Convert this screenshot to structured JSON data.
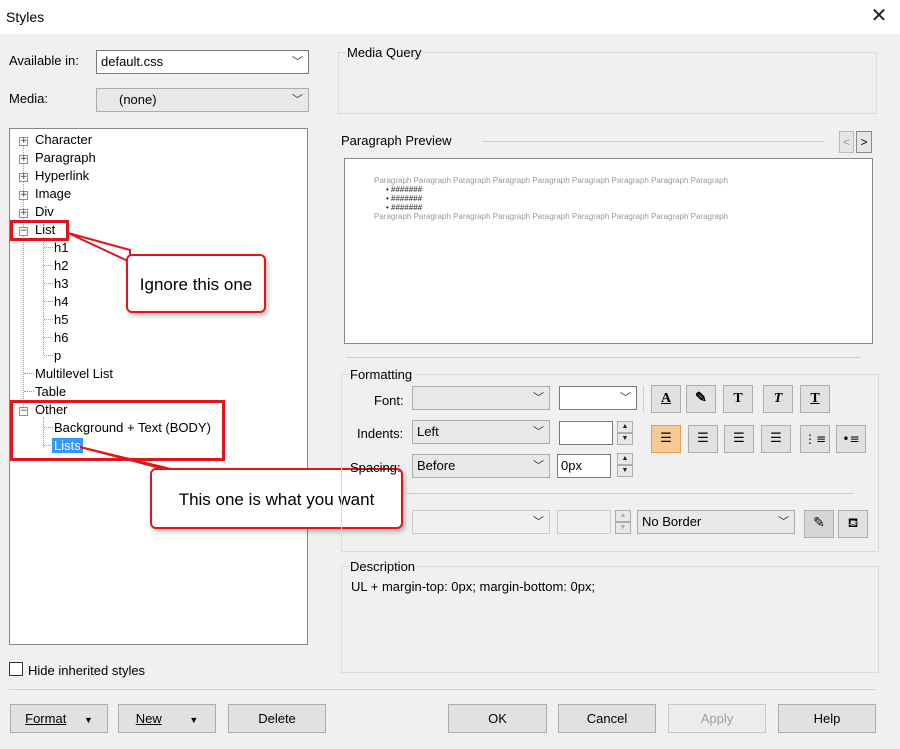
{
  "window": {
    "title": "Styles"
  },
  "available_in": {
    "label": "Available in:",
    "value": "default.css"
  },
  "media": {
    "label": "Media:",
    "value": "(none)"
  },
  "tree": {
    "character": "Character",
    "paragraph": "Paragraph",
    "hyperlink": "Hyperlink",
    "image": "Image",
    "div": "Div",
    "list": "List",
    "list_children": [
      "h1",
      "h2",
      "h3",
      "h4",
      "h5",
      "h6",
      "p"
    ],
    "multilevel_list": "Multilevel List",
    "table": "Table",
    "other": "Other",
    "other_children": [
      "Background + Text (BODY)",
      "Lists"
    ]
  },
  "callouts": {
    "ignore": "Ignore this one",
    "want": "This one is what you want"
  },
  "hide_inherited": {
    "label": "Hide inherited styles",
    "checked": false
  },
  "media_query": {
    "title": "Media Query"
  },
  "preview": {
    "title": "Paragraph Preview",
    "prev": "<",
    "next": ">",
    "para": "Paragraph Paragraph Paragraph Paragraph Paragraph Paragraph Paragraph Paragraph Paragraph",
    "bullets": [
      "#######",
      "#######",
      "#######"
    ]
  },
  "formatting": {
    "title": "Formatting",
    "font_label": "Font:",
    "font_value": "",
    "size_value": "",
    "indents_label": "Indents:",
    "indents_value": "Left",
    "indent_amount": "",
    "spacing_label": "Spacing:",
    "spacing_value": "Before",
    "spacing_amount": "0px",
    "border_value": "No Border",
    "text_buttons": [
      "A",
      "T",
      "T",
      "T"
    ]
  },
  "description": {
    "title": "Description",
    "text": "UL +  margin-top: 0px;  margin-bottom: 0px;"
  },
  "buttons": {
    "format": "Format",
    "new": "New",
    "delete": "Delete",
    "ok": "OK",
    "cancel": "Cancel",
    "apply": "Apply",
    "help": "Help"
  },
  "colors": {
    "selection": "#3399ff",
    "annotation": "#e0161b",
    "active_button": "#f7c995"
  }
}
